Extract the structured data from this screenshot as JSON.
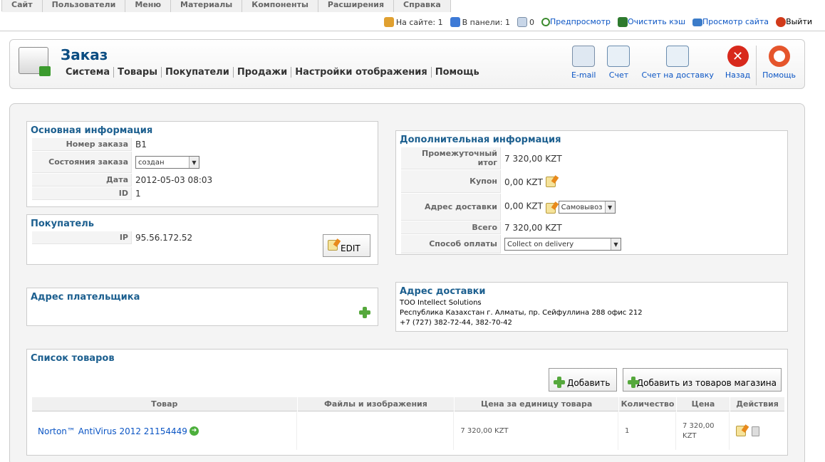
{
  "mainmenu": [
    "Сайт",
    "Пользователи",
    "Меню",
    "Материалы",
    "Компоненты",
    "Расширения",
    "Справка"
  ],
  "status": {
    "online": "На сайте: 1",
    "panel": "В панели: 1",
    "messages": "0",
    "preview": "Предпросмотр",
    "clear_cache": "Очистить кэш",
    "view_site": "Просмотр сайта",
    "logout": "Выйти"
  },
  "page": {
    "title": "Заказ",
    "submenu": [
      "Система",
      "Товары",
      "Покупатели",
      "Продажи",
      "Настройки отображения",
      "Помощь"
    ]
  },
  "toolbar": {
    "email": "E-mail",
    "invoice": "Счет",
    "delivery_invoice": "Счет на доставку",
    "back": "Назад",
    "help": "Помощь"
  },
  "basic": {
    "title": "Основная информация",
    "number_label": "Номер заказа",
    "number": "B1",
    "state_label": "Состояния заказа",
    "state": "создан",
    "date_label": "Дата",
    "date": "2012-05-03 08:03",
    "id_label": "ID",
    "id": "1"
  },
  "buyer": {
    "title": "Покупатель",
    "ip_label": "IP",
    "ip": "95.56.172.52",
    "edit": "EDIT"
  },
  "extra": {
    "title": "Дополнительная информация",
    "subtotal_label": "Промежуточный итог",
    "subtotal": "7 320,00 KZT",
    "coupon_label": "Купон",
    "coupon": "0,00 KZT",
    "shipping_label": "Адрес доставки",
    "shipping": "0,00 KZT",
    "shipping_method": "Самовывоз",
    "total_label": "Всего",
    "total": "7 320,00 KZT",
    "payment_label": "Способ оплаты",
    "payment": "Collect on delivery"
  },
  "payer_address": {
    "title": "Адрес плательщика"
  },
  "delivery_address": {
    "title": "Адрес доставки",
    "line1": "ТОО Intellect Solutions",
    "line2": "Республика Казахстан г. Алматы, пр. Сейфуллина 288 офис 212",
    "line3": "+7 (727) 382-72-44, 382-70-42"
  },
  "products": {
    "title": "Список товаров",
    "add": "Добавить",
    "add_from_store": "Добавить из товаров магазина",
    "columns": [
      "Товар",
      "Файлы и изображения",
      "Цена за единицу товара",
      "Количество",
      "Цена",
      "Действия"
    ],
    "rows": [
      {
        "name": "Norton™ AntiVirus 2012 21154449",
        "files": "",
        "unit_price": "7 320,00 KZT",
        "qty": "1",
        "price": "7 320,00 KZT"
      }
    ]
  }
}
